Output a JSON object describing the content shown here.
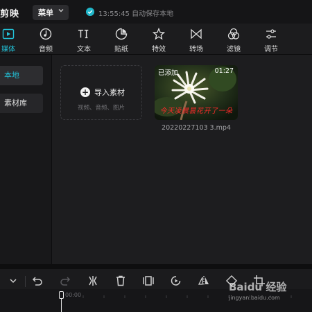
{
  "app": {
    "title": "剪映",
    "menu_label": "菜单",
    "save_status": "13:55:45 自动保存本地"
  },
  "colors": {
    "accent": "#22c3d9",
    "caption_red": "#ff2a2a"
  },
  "toolbar": {
    "items": [
      {
        "label": "媒体",
        "icon": "media-icon",
        "active": true
      },
      {
        "label": "音频",
        "icon": "audio-icon"
      },
      {
        "label": "文本",
        "icon": "text-icon"
      },
      {
        "label": "贴纸",
        "icon": "sticker-icon"
      },
      {
        "label": "特效",
        "icon": "effects-icon"
      },
      {
        "label": "转场",
        "icon": "transition-icon"
      },
      {
        "label": "滤镜",
        "icon": "filter-icon"
      },
      {
        "label": "调节",
        "icon": "adjust-icon"
      }
    ]
  },
  "sidebar": {
    "items": [
      {
        "label": "本地",
        "active": true
      },
      {
        "label": "素材库"
      }
    ]
  },
  "import": {
    "label": "导入素材",
    "sub": "视频、音频、图片"
  },
  "clip": {
    "badge": "已添加",
    "duration": "01:27",
    "caption": "今天凌晨昙花开了一朵",
    "filename": "20220227103 3.mp4"
  },
  "timeline": {
    "time_start": "00:00"
  },
  "watermark": {
    "text": "Baidu 经验",
    "url": "jingyan.baidu.com"
  }
}
